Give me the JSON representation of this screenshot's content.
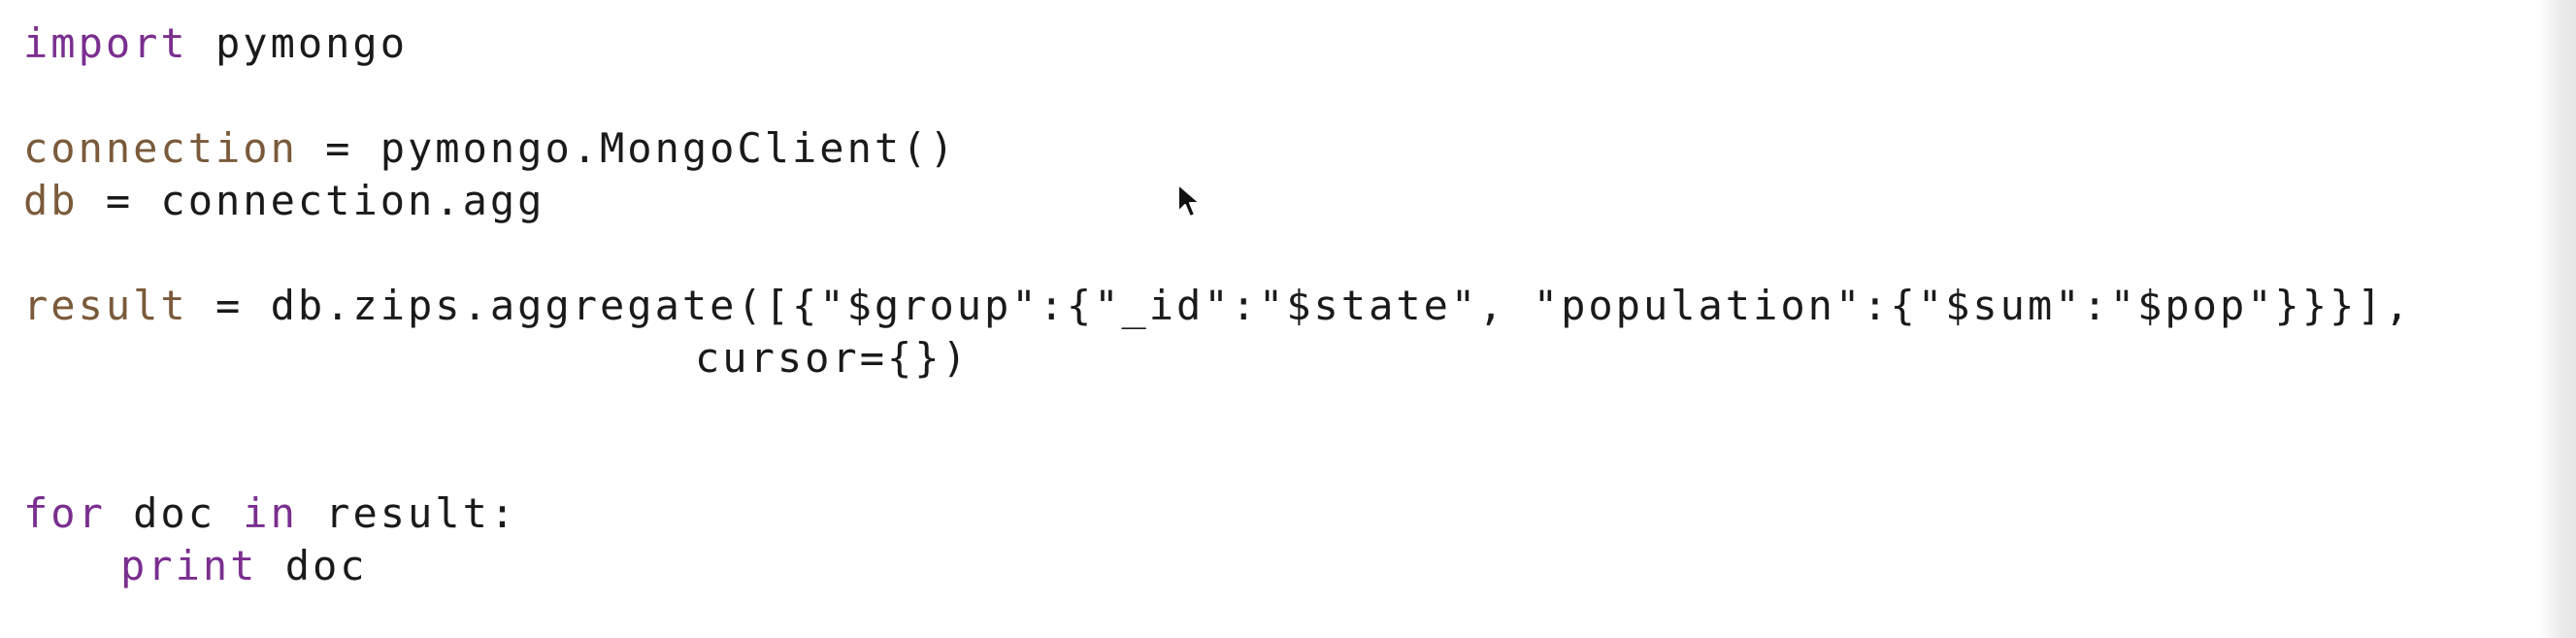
{
  "code": {
    "line1": {
      "kw": "import",
      "rest": " pymongo"
    },
    "line2": {
      "var": "connection",
      "rest": " = pymongo.MongoClient()"
    },
    "line3": {
      "var": "db",
      "rest": " = connection.agg"
    },
    "line4": {
      "var": "result",
      "op": " = db.zips.aggregate([{",
      "s_group": "\"$group\"",
      "p1": ":{",
      "s_id": "\"_id\"",
      "p2": ":",
      "s_state": "\"$state\"",
      "p3": ", ",
      "s_population": "\"population\"",
      "p4": ":{",
      "s_sum": "\"$sum\"",
      "p5": ":",
      "s_pop": "\"$pop\"",
      "p6": "}}}],"
    },
    "line5": {
      "rest": "cursor={})"
    },
    "line6": {
      "kw_for": "for",
      "mid": " doc ",
      "kw_in": "in",
      "rest": " result:"
    },
    "line7": {
      "kw_print": "print",
      "rest": " doc"
    }
  },
  "icons": {
    "mouse_pointer": "arrow-pointer-icon"
  },
  "colors": {
    "keyword": "#7a2e8f",
    "variable": "#7a5a3a",
    "text": "#1a1a1a",
    "background": "#ffffff"
  }
}
